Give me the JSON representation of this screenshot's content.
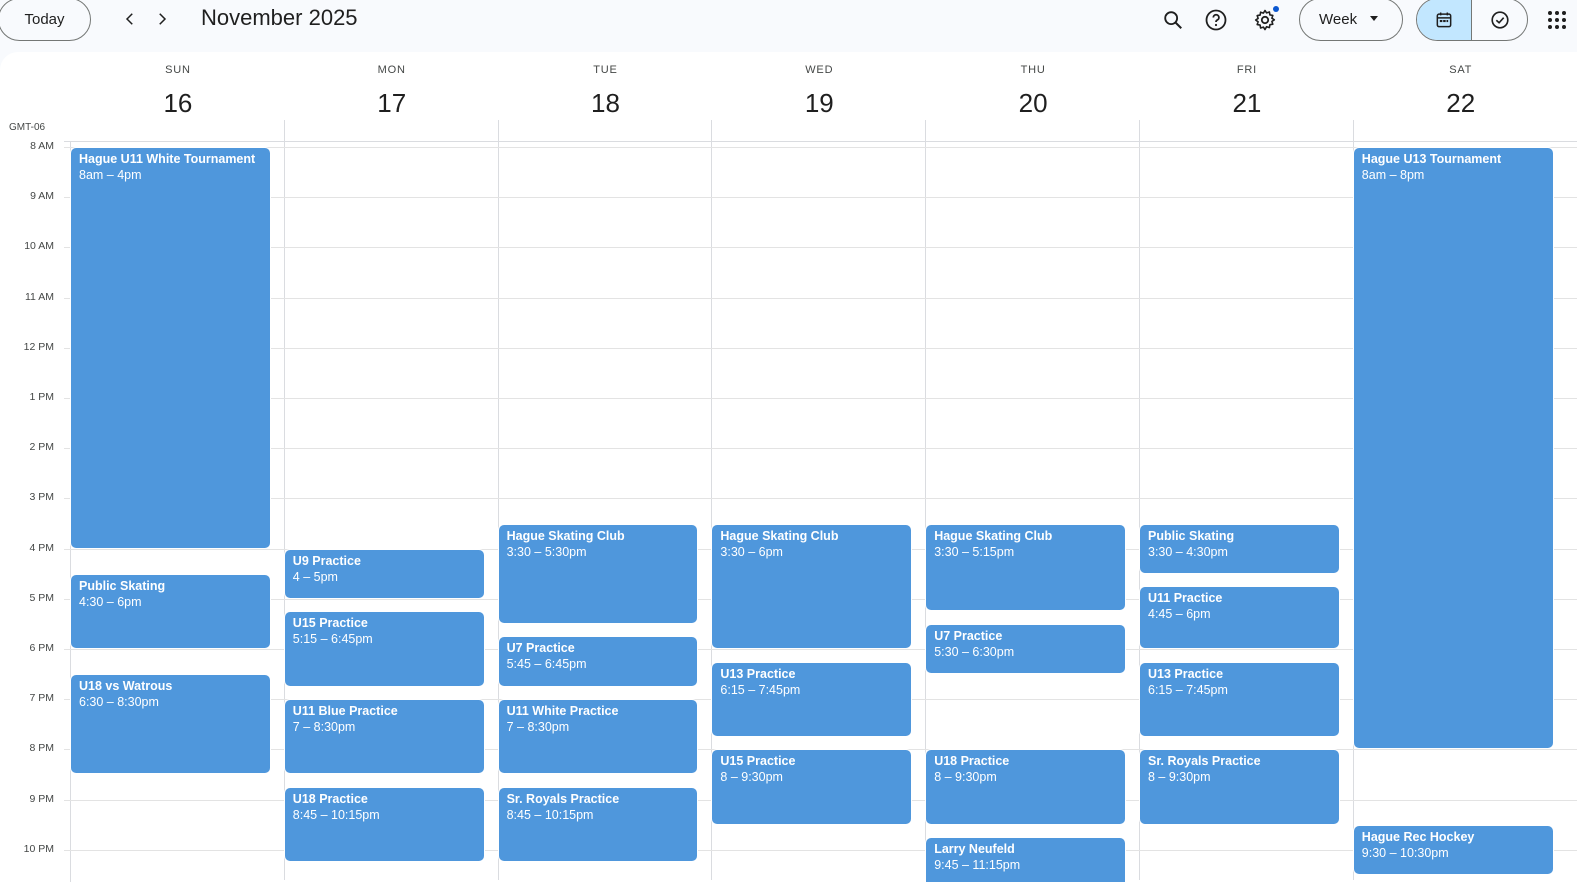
{
  "toolbar": {
    "today_label": "Today",
    "title": "November 2025",
    "view_label": "Week",
    "icons": [
      "chevron-left-icon",
      "chevron-right-icon",
      "search-icon",
      "help-icon",
      "gear-icon",
      "calendar-icon",
      "tasks-check-icon",
      "apps-grid-icon"
    ]
  },
  "timezone": "GMT-06",
  "days": [
    {
      "name": "SUN",
      "num": "16"
    },
    {
      "name": "MON",
      "num": "17"
    },
    {
      "name": "TUE",
      "num": "18"
    },
    {
      "name": "WED",
      "num": "19"
    },
    {
      "name": "THU",
      "num": "20"
    },
    {
      "name": "FRI",
      "num": "21"
    },
    {
      "name": "SAT",
      "num": "22"
    }
  ],
  "hours": [
    "8 AM",
    "9 AM",
    "10 AM",
    "11 AM",
    "12 PM",
    "1 PM",
    "2 PM",
    "3 PM",
    "4 PM",
    "5 PM",
    "6 PM",
    "7 PM",
    "8 PM",
    "9 PM",
    "10 PM"
  ],
  "colors": {
    "event": "#4f97dc",
    "active_view": "#c2e7ff",
    "notification_dot": "#0b57d0"
  },
  "events": [
    {
      "day": 0,
      "start": 8.0,
      "end": 16.0,
      "title": "Hague U11 White Tournament",
      "time": "8am – 4pm"
    },
    {
      "day": 0,
      "start": 16.5,
      "end": 18.0,
      "title": "Public Skating",
      "time": "4:30 – 6pm"
    },
    {
      "day": 0,
      "start": 18.5,
      "end": 20.5,
      "title": "U18 vs Watrous",
      "time": "6:30 – 8:30pm"
    },
    {
      "day": 1,
      "start": 16.0,
      "end": 17.0,
      "title": "U9 Practice",
      "time": "4 – 5pm"
    },
    {
      "day": 1,
      "start": 17.25,
      "end": 18.75,
      "title": "U15 Practice",
      "time": "5:15 – 6:45pm"
    },
    {
      "day": 1,
      "start": 19.0,
      "end": 20.5,
      "title": "U11 Blue Practice",
      "time": "7 – 8:30pm"
    },
    {
      "day": 1,
      "start": 20.75,
      "end": 22.25,
      "title": "U18 Practice",
      "time": "8:45 – 10:15pm"
    },
    {
      "day": 2,
      "start": 15.5,
      "end": 17.5,
      "title": "Hague Skating Club",
      "time": "3:30 – 5:30pm"
    },
    {
      "day": 2,
      "start": 17.75,
      "end": 18.75,
      "title": "U7 Practice",
      "time": "5:45 – 6:45pm"
    },
    {
      "day": 2,
      "start": 19.0,
      "end": 20.5,
      "title": "U11 White Practice",
      "time": "7 – 8:30pm"
    },
    {
      "day": 2,
      "start": 20.75,
      "end": 22.25,
      "title": "Sr. Royals Practice",
      "time": "8:45 – 10:15pm"
    },
    {
      "day": 3,
      "start": 15.5,
      "end": 18.0,
      "title": "Hague Skating Club",
      "time": "3:30 – 6pm"
    },
    {
      "day": 3,
      "start": 18.25,
      "end": 19.75,
      "title": "U13 Practice",
      "time": "6:15 – 7:45pm"
    },
    {
      "day": 3,
      "start": 20.0,
      "end": 21.5,
      "title": "U15 Practice",
      "time": "8 – 9:30pm"
    },
    {
      "day": 4,
      "start": 15.5,
      "end": 17.25,
      "title": "Hague Skating Club",
      "time": "3:30 – 5:15pm"
    },
    {
      "day": 4,
      "start": 17.5,
      "end": 18.5,
      "title": "U7 Practice",
      "time": "5:30 – 6:30pm"
    },
    {
      "day": 4,
      "start": 20.0,
      "end": 21.5,
      "title": "U18 Practice",
      "time": "8 – 9:30pm"
    },
    {
      "day": 4,
      "start": 21.75,
      "end": 23.25,
      "title": "Larry Neufeld",
      "time": "9:45 – 11:15pm"
    },
    {
      "day": 5,
      "start": 15.5,
      "end": 16.5,
      "title": "Public Skating",
      "time": "3:30 – 4:30pm"
    },
    {
      "day": 5,
      "start": 16.75,
      "end": 18.0,
      "title": "U11 Practice",
      "time": "4:45 – 6pm"
    },
    {
      "day": 5,
      "start": 18.25,
      "end": 19.75,
      "title": "U13 Practice",
      "time": "6:15 – 7:45pm"
    },
    {
      "day": 5,
      "start": 20.0,
      "end": 21.5,
      "title": "Sr. Royals Practice",
      "time": "8 – 9:30pm"
    },
    {
      "day": 6,
      "start": 8.0,
      "end": 20.0,
      "title": "Hague U13 Tournament",
      "time": "8am – 8pm"
    },
    {
      "day": 6,
      "start": 21.5,
      "end": 22.5,
      "title": "Hague Rec Hockey",
      "time": "9:30 – 10:30pm"
    }
  ]
}
